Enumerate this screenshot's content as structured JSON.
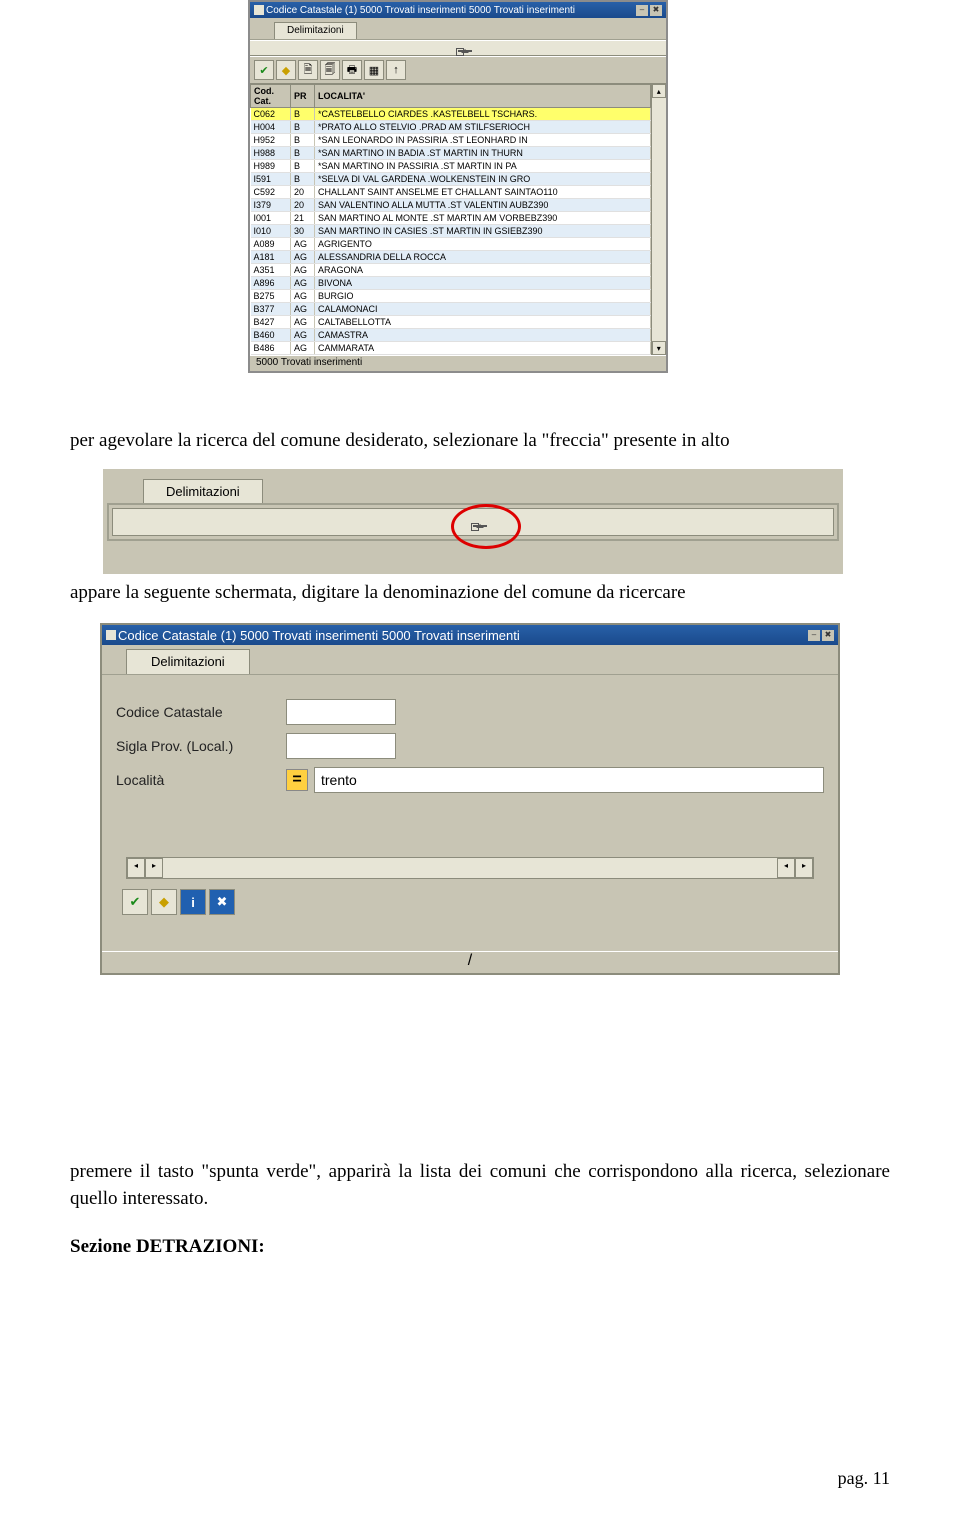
{
  "fig1": {
    "title": "Codice Catastale (1) 5000 Trovati inserimenti 5000 Trovati inserimenti",
    "tab": "Delimitazioni",
    "headers": {
      "c1": "Cod. Cat.",
      "c2": "PR",
      "c3": "LOCALITA'"
    },
    "rows": [
      {
        "a": "C062",
        "b": "B",
        "c": "*CASTELBELLO CIARDES .KASTELBELL TSCHARS.",
        "hl": true
      },
      {
        "a": "H004",
        "b": "B",
        "c": "*PRATO ALLO STELVIO .PRAD AM STILFSERIOCH"
      },
      {
        "a": "H952",
        "b": "B",
        "c": "*SAN LEONARDO IN PASSIRIA .ST LEONHARD IN"
      },
      {
        "a": "H988",
        "b": "B",
        "c": "*SAN MARTINO IN BADIA .ST MARTIN IN THURN"
      },
      {
        "a": "H989",
        "b": "B",
        "c": "*SAN MARTINO IN PASSIRIA .ST MARTIN IN PA"
      },
      {
        "a": "I591",
        "b": "B",
        "c": "*SELVA DI VAL GARDENA .WOLKENSTEIN IN GRO"
      },
      {
        "a": "C592",
        "b": "20",
        "c": "CHALLANT SAINT ANSELME ET CHALLANT SAINTAO110"
      },
      {
        "a": "I379",
        "b": "20",
        "c": "SAN VALENTINO ALLA MUTTA .ST VALENTIN AUBZ390"
      },
      {
        "a": "I001",
        "b": "21",
        "c": "SAN MARTINO AL MONTE .ST MARTIN AM VORBEBZ390"
      },
      {
        "a": "I010",
        "b": "30",
        "c": "SAN MARTINO IN CASIES .ST MARTIN IN GSIEBZ390"
      },
      {
        "a": "A089",
        "b": "AG",
        "c": "AGRIGENTO"
      },
      {
        "a": "A181",
        "b": "AG",
        "c": "ALESSANDRIA DELLA ROCCA"
      },
      {
        "a": "A351",
        "b": "AG",
        "c": "ARAGONA"
      },
      {
        "a": "A896",
        "b": "AG",
        "c": "BIVONA"
      },
      {
        "a": "B275",
        "b": "AG",
        "c": "BURGIO"
      },
      {
        "a": "B377",
        "b": "AG",
        "c": "CALAMONACI"
      },
      {
        "a": "B427",
        "b": "AG",
        "c": "CALTABELLOTTA"
      },
      {
        "a": "B460",
        "b": "AG",
        "c": "CAMASTRA"
      },
      {
        "a": "B486",
        "b": "AG",
        "c": "CAMMARATA"
      }
    ],
    "status": "5000 Trovati inserimenti"
  },
  "text": {
    "p1": "per agevolare la ricerca del comune desiderato, selezionare la \"freccia\" presente in alto",
    "p2": "appare la seguente schermata, digitare la denominazione del comune da ricercare",
    "p3": "premere il tasto \"spunta verde\", apparirà la lista dei comuni che corrispondono alla ricerca, selezionare quello interessato.",
    "p4": "Sezione DETRAZIONI:"
  },
  "fig2": {
    "tab": "Delimitazioni"
  },
  "fig3": {
    "title": "Codice Catastale (1) 5000 Trovati inserimenti 5000 Trovati inserimenti",
    "tab": "Delimitazioni",
    "labels": {
      "codice": "Codice Catastale",
      "sigla": "Sigla Prov. (Local.)",
      "localita": "Località"
    },
    "values": {
      "codice": "",
      "sigla": "",
      "localita": "trento"
    },
    "eq": "="
  },
  "icons": {
    "check": "✔",
    "diamond": "◆",
    "r1": "🗎",
    "r2": "🗐",
    "print": "🖶",
    "doc": "▦",
    "up": "↑",
    "info": "i",
    "x": "✖",
    "tri_up": "▴",
    "tri_down": "▾",
    "tri_l": "◂",
    "tri_r": "▸",
    "slash": "/",
    "minus": "–"
  },
  "footer": {
    "page": "pag. 11"
  }
}
